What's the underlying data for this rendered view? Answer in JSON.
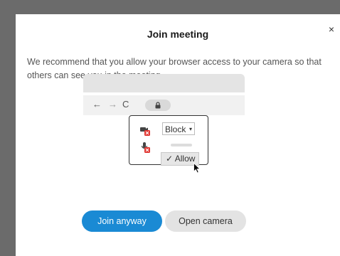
{
  "dialog": {
    "title": "Join meeting",
    "close_label": "×",
    "description": "We recommend that you allow your browser access to your camera so that others can see you in the meeting."
  },
  "illustration": {
    "nav_back": "←",
    "nav_forward": "→",
    "nav_reload": "C",
    "select_value": "Block",
    "select_caret": "▾",
    "allow_option": "✓ Allow"
  },
  "buttons": {
    "join_anyway": "Join anyway",
    "open_camera": "Open camera"
  },
  "colors": {
    "primary": "#1a8ad4",
    "secondary": "#e3e3e3",
    "blocked_badge": "#e0342f"
  }
}
